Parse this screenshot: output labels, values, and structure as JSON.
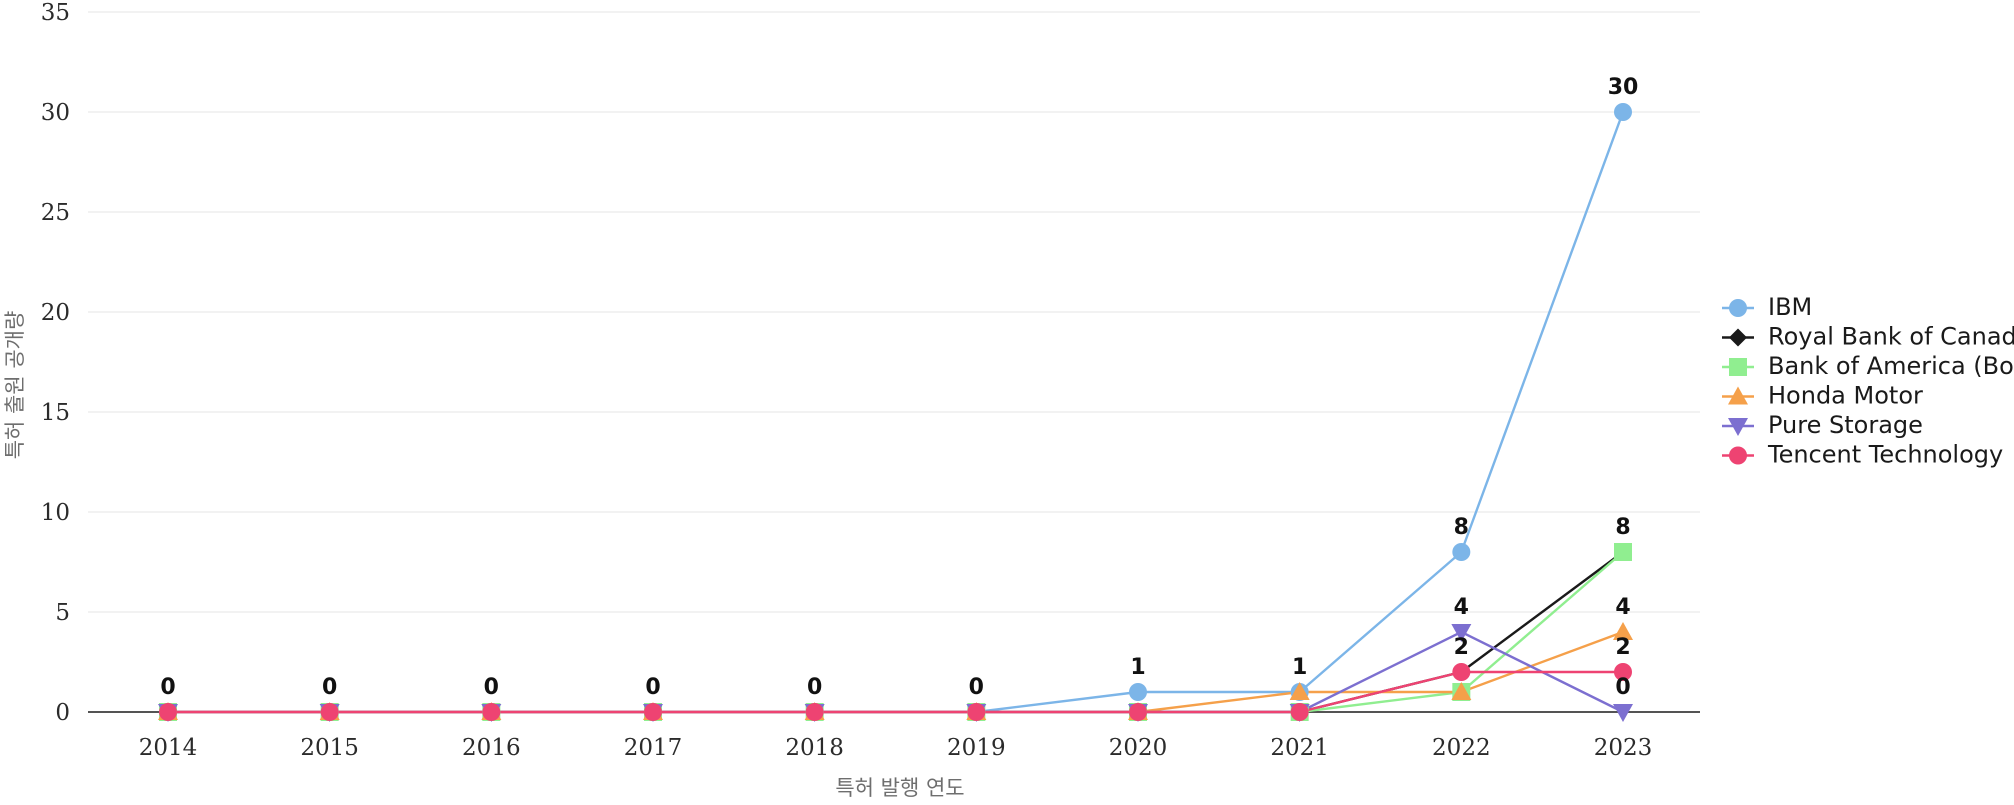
{
  "chart_data": {
    "type": "line",
    "title": "",
    "xlabel": "특허 발행 연도",
    "ylabel": "특허 출원 공개량",
    "categories": [
      "2014",
      "2015",
      "2016",
      "2017",
      "2018",
      "2019",
      "2020",
      "2021",
      "2022",
      "2023"
    ],
    "ylim": [
      0,
      35
    ],
    "yticks": [
      0,
      5,
      10,
      15,
      20,
      25,
      30,
      35
    ],
    "ytick_labels": [
      "0",
      "5",
      "10",
      "15",
      "20",
      "25",
      "30",
      "35"
    ],
    "grid": true,
    "legend_position": "right",
    "series": [
      {
        "name": "IBM",
        "color": "#7CB5E8",
        "marker": "circle",
        "values": [
          0,
          0,
          0,
          0,
          0,
          0,
          1,
          1,
          8,
          30
        ]
      },
      {
        "name": "Royal Bank of Canada (RBC)",
        "color": "#1A1A1A",
        "marker": "diamond",
        "values": [
          0,
          0,
          0,
          0,
          0,
          0,
          0,
          0,
          2,
          8
        ]
      },
      {
        "name": "Bank of America (BoFA)",
        "color": "#90EE90",
        "marker": "square",
        "values": [
          0,
          0,
          0,
          0,
          0,
          0,
          0,
          0,
          1,
          8
        ]
      },
      {
        "name": "Honda Motor",
        "color": "#F5A04A",
        "marker": "triangle-up",
        "values": [
          0,
          0,
          0,
          0,
          0,
          0,
          0,
          1,
          1,
          4
        ]
      },
      {
        "name": "Pure Storage",
        "color": "#7C6FD0",
        "marker": "triangle-down",
        "values": [
          0,
          0,
          0,
          0,
          0,
          0,
          0,
          0,
          4,
          0
        ]
      },
      {
        "name": "Tencent Technology",
        "color": "#EE4372",
        "marker": "circle",
        "values": [
          0,
          0,
          0,
          0,
          0,
          0,
          0,
          0,
          2,
          2
        ]
      }
    ],
    "data_labels": [
      {
        "text": "0",
        "x_cat": "2014",
        "value": 0
      },
      {
        "text": "0",
        "x_cat": "2015",
        "value": 0
      },
      {
        "text": "0",
        "x_cat": "2016",
        "value": 0
      },
      {
        "text": "0",
        "x_cat": "2017",
        "value": 0
      },
      {
        "text": "0",
        "x_cat": "2018",
        "value": 0
      },
      {
        "text": "0",
        "x_cat": "2019",
        "value": 0
      },
      {
        "text": "1",
        "x_cat": "2020",
        "value": 1
      },
      {
        "text": "1",
        "x_cat": "2021",
        "value": 1
      },
      {
        "text": "8",
        "x_cat": "2022",
        "value": 8
      },
      {
        "text": "4",
        "x_cat": "2022",
        "value": 4
      },
      {
        "text": "2",
        "x_cat": "2022",
        "value": 2
      },
      {
        "text": "30",
        "x_cat": "2023",
        "value": 30
      },
      {
        "text": "8",
        "x_cat": "2023",
        "value": 8
      },
      {
        "text": "4",
        "x_cat": "2023",
        "value": 4
      },
      {
        "text": "2",
        "x_cat": "2023",
        "value": 2
      },
      {
        "text": "0",
        "x_cat": "2023",
        "value": 0
      }
    ]
  }
}
